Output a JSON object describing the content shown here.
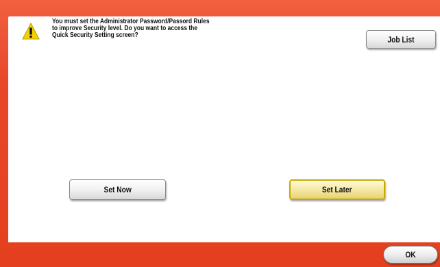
{
  "dialog": {
    "message_lines": [
      "You must set the Administrator Password/Passord Rules",
      "to improve Security level.  Do you want to access the",
      "Quick Security Setting screen?"
    ],
    "warning_icon": "warning-triangle-icon"
  },
  "buttons": {
    "job_list": "Job List",
    "set_now": "Set Now",
    "set_later": "Set Later",
    "ok": "OK"
  },
  "colors": {
    "frame": "#e8472a",
    "panel": "#ffffff",
    "highlight_button": "#f6e9a6",
    "warning_yellow": "#f5d000"
  }
}
